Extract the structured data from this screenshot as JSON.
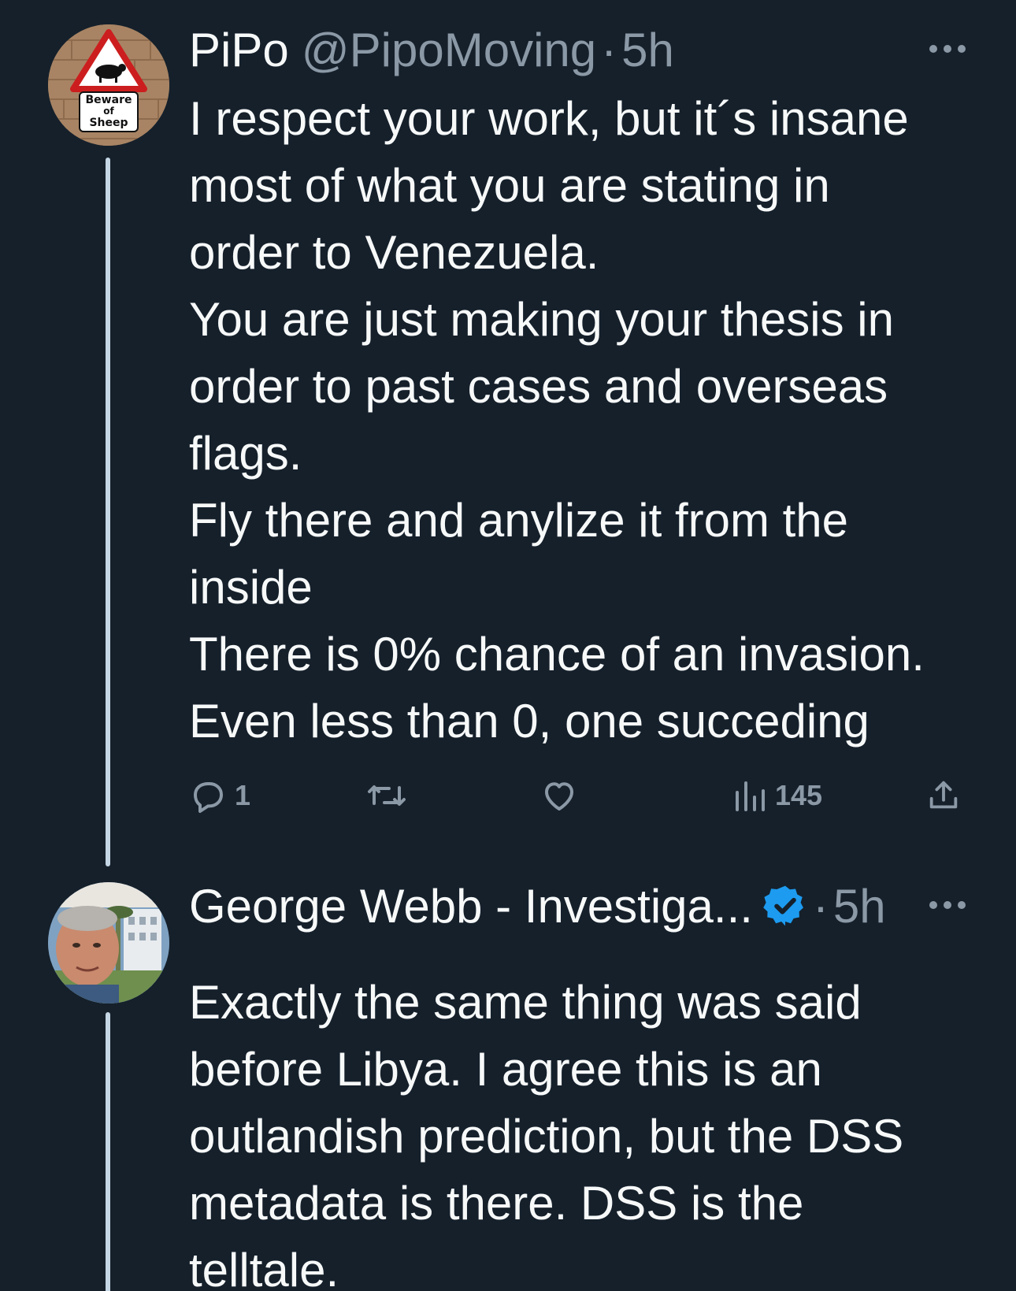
{
  "tweets": [
    {
      "display_name": "PiPo",
      "handle": "@PipoMoving",
      "separator": "·",
      "time": "5h",
      "avatar": {
        "type": "warning-sign",
        "lines": [
          "Beware",
          "of",
          "Sheep"
        ]
      },
      "verified": false,
      "text_lines": [
        "I respect your work, but it´s insane",
        "most of what you are stating in",
        "order to Venezuela.",
        "You are just making your thesis in",
        "order to past cases and overseas",
        "flags.",
        "Fly there and anylize it from the",
        "inside",
        "There is 0% chance of an invasion.",
        "Even less than 0, one succeding"
      ],
      "actions": {
        "reply_count": "1",
        "retweet_count": "",
        "like_count": "",
        "views_count": "145"
      }
    },
    {
      "display_name": "George Webb - Investiga...",
      "separator": "·",
      "time": "5h",
      "verified": true,
      "avatar": {
        "type": "photo"
      },
      "text_lines": [
        "Exactly the same thing was said",
        "before Libya.  I agree this is an",
        "outlandish prediction, but the DSS",
        "metadata is there. DSS is the",
        "telltale."
      ]
    }
  ],
  "icons": {
    "reply": "reply-icon",
    "retweet": "retweet-icon",
    "like": "heart-icon",
    "views": "views-icon",
    "share": "share-icon",
    "more": "more-icon",
    "verified": "verified-badge-icon"
  },
  "colors": {
    "background": "#15202b",
    "primary_text": "#f7f9f9",
    "secondary_text": "#8b98a5",
    "verified_blue": "#1d9bf0",
    "thread_line": "#c5d6e4"
  }
}
